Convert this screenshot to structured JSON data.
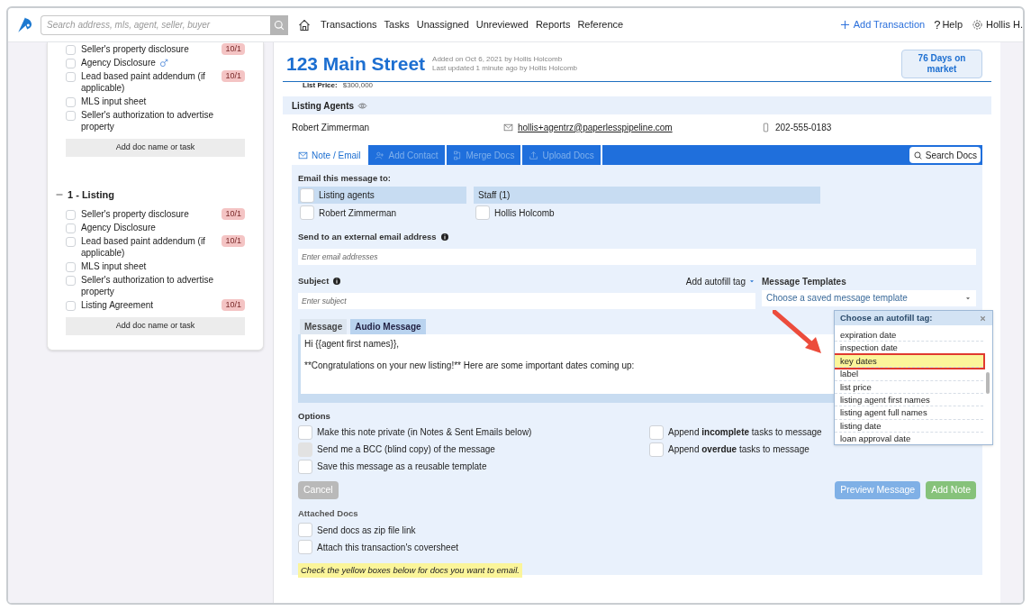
{
  "topbar": {
    "search": {
      "placeholder": "Search address, mls, agent, seller, buyer"
    },
    "nav": [
      "Transactions",
      "Tasks",
      "Unassigned",
      "Unreviewed",
      "Reports",
      "Reference"
    ],
    "add_transaction": "Add Transaction",
    "help_icon": "?",
    "help": "Help",
    "user": "Hollis H."
  },
  "sidebar": {
    "groups": [
      {
        "items": [
          {
            "label": "Seller's property disclosure",
            "checked": false,
            "due": "10/1"
          },
          {
            "label": "Agency Disclosure",
            "checked": false,
            "linked": true
          },
          {
            "label": "Lead based paint addendum (if applicable)",
            "checked": false,
            "due": "10/1"
          },
          {
            "label": "MLS input sheet",
            "checked": false
          },
          {
            "label": "Seller's authorization to advertise property",
            "checked": false
          }
        ],
        "add": "Add doc name or task"
      },
      {
        "title": "1 - Listing",
        "expanded": true,
        "items": [
          {
            "label": "Seller's property disclosure",
            "checked": false,
            "due": "10/1"
          },
          {
            "label": "Agency Disclosure",
            "checked": false
          },
          {
            "label": "Lead based paint addendum (if applicable)",
            "checked": false,
            "due": "10/1"
          },
          {
            "label": "MLS input sheet",
            "checked": false
          },
          {
            "label": "Seller's authorization to advertise property",
            "checked": false
          },
          {
            "label": "Listing Agreement",
            "checked": false,
            "due": "10/1"
          }
        ],
        "add": "Add doc name or task"
      }
    ]
  },
  "header": {
    "title": "123 Main Street",
    "added": "Added on Oct 6, 2021 by Hollis Holcomb",
    "updated": "Last updated 1 minute ago by Hollis Holcomb",
    "days": "76 Days on market",
    "list_price_label": "List Price:",
    "list_price": "$300,000"
  },
  "listing_agents": {
    "title": "Listing Agents",
    "name": "Robert Zimmerman",
    "email": "hollis+agentrz@paperlesspipeline.com",
    "phone": "202-555-0183"
  },
  "toolbar": [
    {
      "label": "Note / Email",
      "selected": true,
      "disabled": false
    },
    {
      "label": "Add Contact",
      "selected": false,
      "disabled": true
    },
    {
      "label": "Merge Docs",
      "selected": false,
      "disabled": true
    },
    {
      "label": "Upload Docs",
      "selected": false,
      "disabled": true
    }
  ],
  "search_docs": "Search Docs",
  "email": {
    "to_label": "Email this message to:",
    "recipients": [
      {
        "group": "Listing agents",
        "group_checked": false,
        "people": [
          {
            "name": "Robert Zimmerman",
            "checked": false
          }
        ]
      },
      {
        "group": "Staff (1)",
        "people": [
          {
            "name": "Hollis Holcomb",
            "checked": false
          }
        ]
      }
    ],
    "external_label": "Send to an external email address",
    "external_placeholder": "Enter email addresses",
    "subject_label": "Subject",
    "subject_placeholder": "Enter subject",
    "autofill": "Add autofill tag",
    "templates_label": "Message Templates",
    "template_placeholder": "Choose a saved message template",
    "message_tabs": [
      {
        "label": "Message",
        "selected": true
      },
      {
        "label": "Audio Message",
        "selected": false
      }
    ],
    "message_lines": [
      "Hi {{agent first names}},",
      "**Congratulations on your new listing!** Here are some important dates coming up:"
    ],
    "options_label": "Options",
    "options": [
      {
        "label": "Make this note private (in Notes & Sent Emails below)",
        "checked": false,
        "disabled": false
      },
      {
        "label": "Send me a BCC (blind copy) of the message",
        "checked": false,
        "disabled": true
      },
      {
        "label": "Save this message as a reusable template",
        "checked": false,
        "disabled": false
      }
    ],
    "append": [
      {
        "label": "Append **incomplete** tasks to message",
        "checked": false
      },
      {
        "label": "Append **overdue** tasks to message",
        "checked": false
      }
    ],
    "cancel": "Cancel",
    "preview": "Preview Message",
    "add_note": "Add Note",
    "attached_label": "Attached Docs",
    "attached": [
      {
        "label": "Send docs as zip file link",
        "checked": false
      },
      {
        "label": "Attach this transaction's coversheet",
        "checked": false
      }
    ],
    "hint": "Check the yellow boxes below for docs you want to email."
  },
  "autofill_menu": {
    "title": "Choose an autofill tag:",
    "items": [
      {
        "label": "expiration date",
        "selected": false
      },
      {
        "label": "inspection date",
        "selected": false
      },
      {
        "label": "key dates",
        "selected": true
      },
      {
        "label": "label",
        "selected": false
      },
      {
        "label": "list price",
        "selected": false
      },
      {
        "label": "listing agent first names",
        "selected": false
      },
      {
        "label": "listing agent full names",
        "selected": false
      },
      {
        "label": "listing date",
        "selected": false
      },
      {
        "label": "loan approval date",
        "selected": false
      }
    ]
  }
}
